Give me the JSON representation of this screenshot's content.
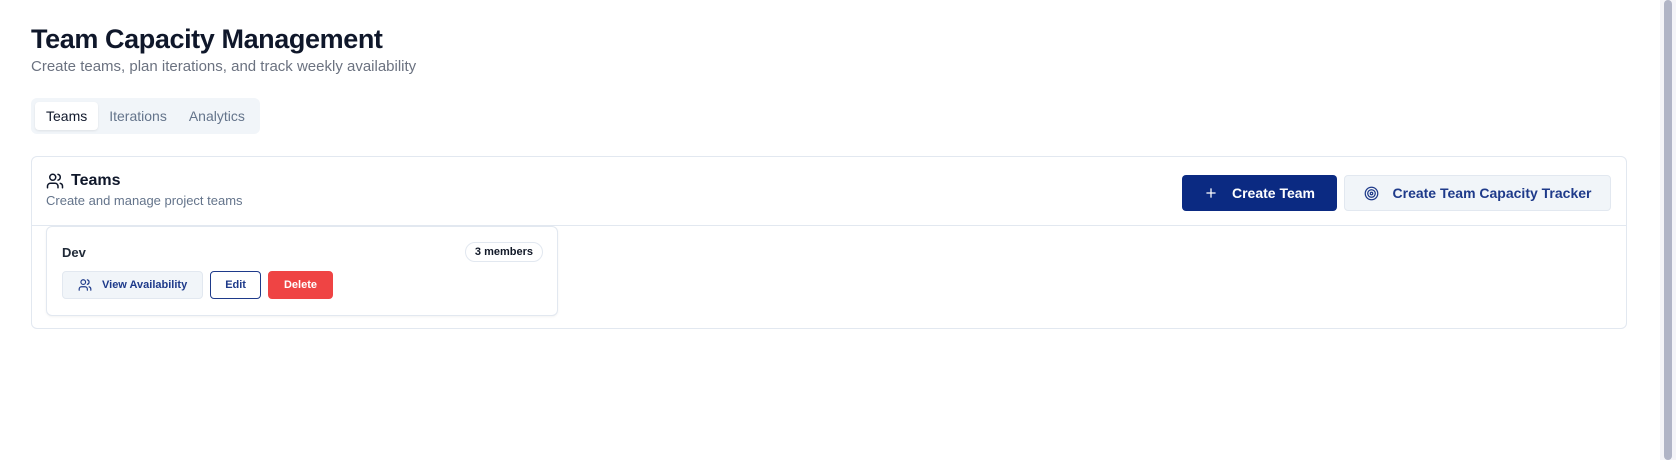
{
  "header": {
    "title": "Team Capacity Management",
    "subtitle": "Create teams, plan iterations, and track weekly availability"
  },
  "tabs": [
    {
      "label": "Teams",
      "active": true
    },
    {
      "label": "Iterations",
      "active": false
    },
    {
      "label": "Analytics",
      "active": false
    }
  ],
  "teams_card": {
    "icon": "users-icon",
    "title": "Teams",
    "description": "Create and manage project teams",
    "create_team_label": "Create Team",
    "create_team_icon": "plus-icon",
    "create_tracker_label": "Create Team Capacity Tracker",
    "create_tracker_icon": "target-icon"
  },
  "teams": [
    {
      "name": "Dev",
      "members_badge": "3 members",
      "view_label": "View Availability",
      "view_icon": "users-icon",
      "edit_label": "Edit",
      "delete_label": "Delete"
    }
  ],
  "colors": {
    "primary": "#0b2a82",
    "danger": "#ef4444",
    "muted_text": "#64748b",
    "border": "#e2e8f0"
  }
}
